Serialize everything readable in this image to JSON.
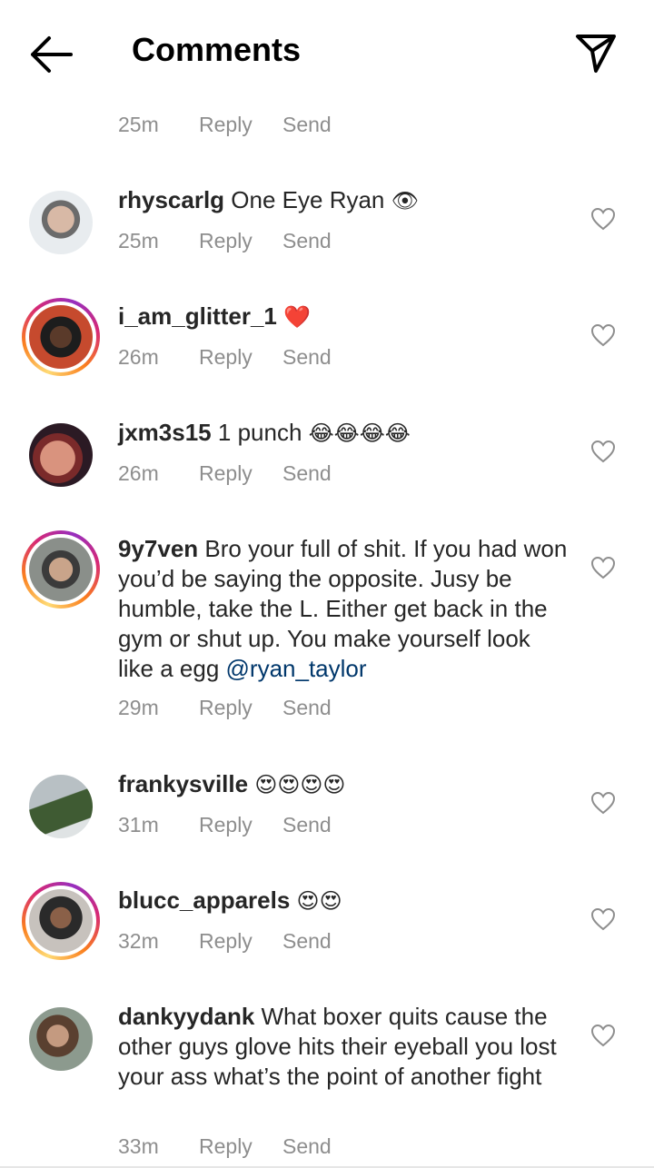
{
  "header": {
    "title": "Comments",
    "back_icon": "arrow-left-icon",
    "send_icon": "paper-plane-icon"
  },
  "top_meta": {
    "time": "25m",
    "reply": "Reply",
    "send": "Send"
  },
  "comments": [
    {
      "username": "rhyscarlg",
      "text": " One Eye Ryan ",
      "emoji": "👁",
      "time": "25m",
      "reply": "Reply",
      "send": "Send",
      "ring": false
    },
    {
      "username": "i_am_glitter_1",
      "text": " ",
      "emoji": "❤️",
      "time": "26m",
      "reply": "Reply",
      "send": "Send",
      "ring": true
    },
    {
      "username": "jxm3s15",
      "text": " 1 punch ",
      "emoji": "😂😂😂😂",
      "time": "26m",
      "reply": "Reply",
      "send": "Send",
      "ring": false
    },
    {
      "username": "9y7ven",
      "text": " Bro your full of shit. If you had won you’d be saying the opposite. Jusy be humble, take the L. Either get back in the gym or shut up. You make yourself look like a egg ",
      "mention": "@ryan_taylor",
      "time": "29m",
      "reply": "Reply",
      "send": "Send",
      "ring": true
    },
    {
      "username": "frankysville",
      "text": " ",
      "emoji": "😍😍😍😍",
      "time": "31m",
      "reply": "Reply",
      "send": "Send",
      "ring": false
    },
    {
      "username": "blucc_apparels",
      "text": " ",
      "emoji": "😍😍",
      "time": "32m",
      "reply": "Reply",
      "send": "Send",
      "ring": true
    },
    {
      "username": "dankyydank",
      "text": " What boxer quits cause the other guys glove hits their eyeball you lost your ass what’s the point of another fight",
      "time": "33m",
      "reply": "Reply",
      "send": "Send",
      "ring": false
    }
  ],
  "colors": {
    "muted": "#8e8e8e",
    "mention": "#00376b",
    "heart_outline": "#8e8e8e"
  }
}
